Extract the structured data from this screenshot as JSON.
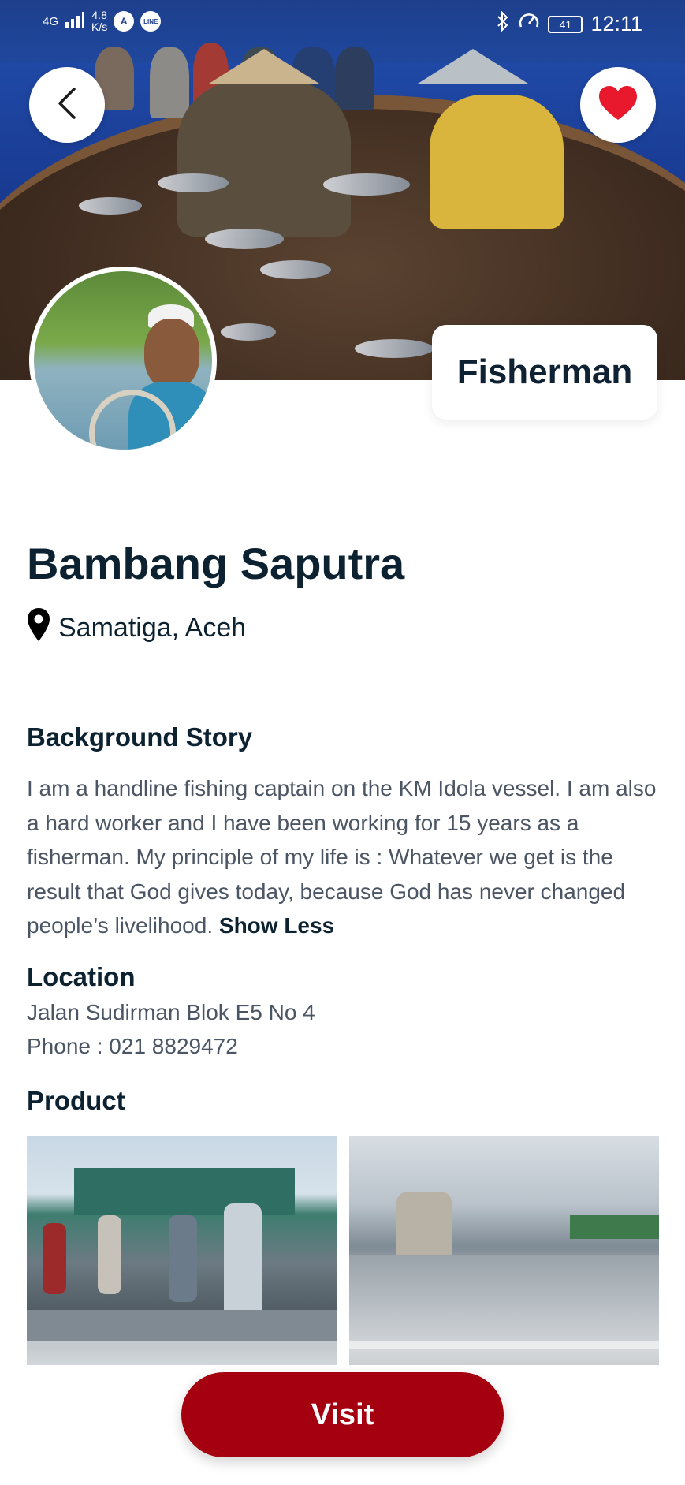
{
  "status_bar": {
    "network": "4G",
    "speed": "4.8",
    "speed_unit": "K/s",
    "app_icon_a": "A",
    "app_icon_line": "LINE",
    "bluetooth_icon": "bluetooth-icon",
    "battery_level": "41",
    "time": "12:11"
  },
  "header": {
    "back_icon": "chevron-left-icon",
    "favorite_icon": "heart-icon",
    "favorite_color": "#e8192c"
  },
  "profile": {
    "role": "Fisherman",
    "name": "Bambang Saputra",
    "location_icon": "map-pin-icon",
    "location": "Samatiga, Aceh"
  },
  "background_story": {
    "title": "Background Story",
    "text": "I am a handline fishing captain on the KM Idola vessel. I am also a hard worker and I have been working for 15 years as a fisherman. My principle of my life is : Whatever we get is the result that God gives today, because God has never changed people’s livelihood.",
    "toggle_label": "Show Less"
  },
  "location_section": {
    "title": "Location",
    "address": "Jalan Sudirman Blok E5 No 4",
    "phone": "Phone : 021 8829472"
  },
  "product_section": {
    "title": "Product"
  },
  "actions": {
    "visit_label": "Visit",
    "accent_color": "#a4000f"
  }
}
